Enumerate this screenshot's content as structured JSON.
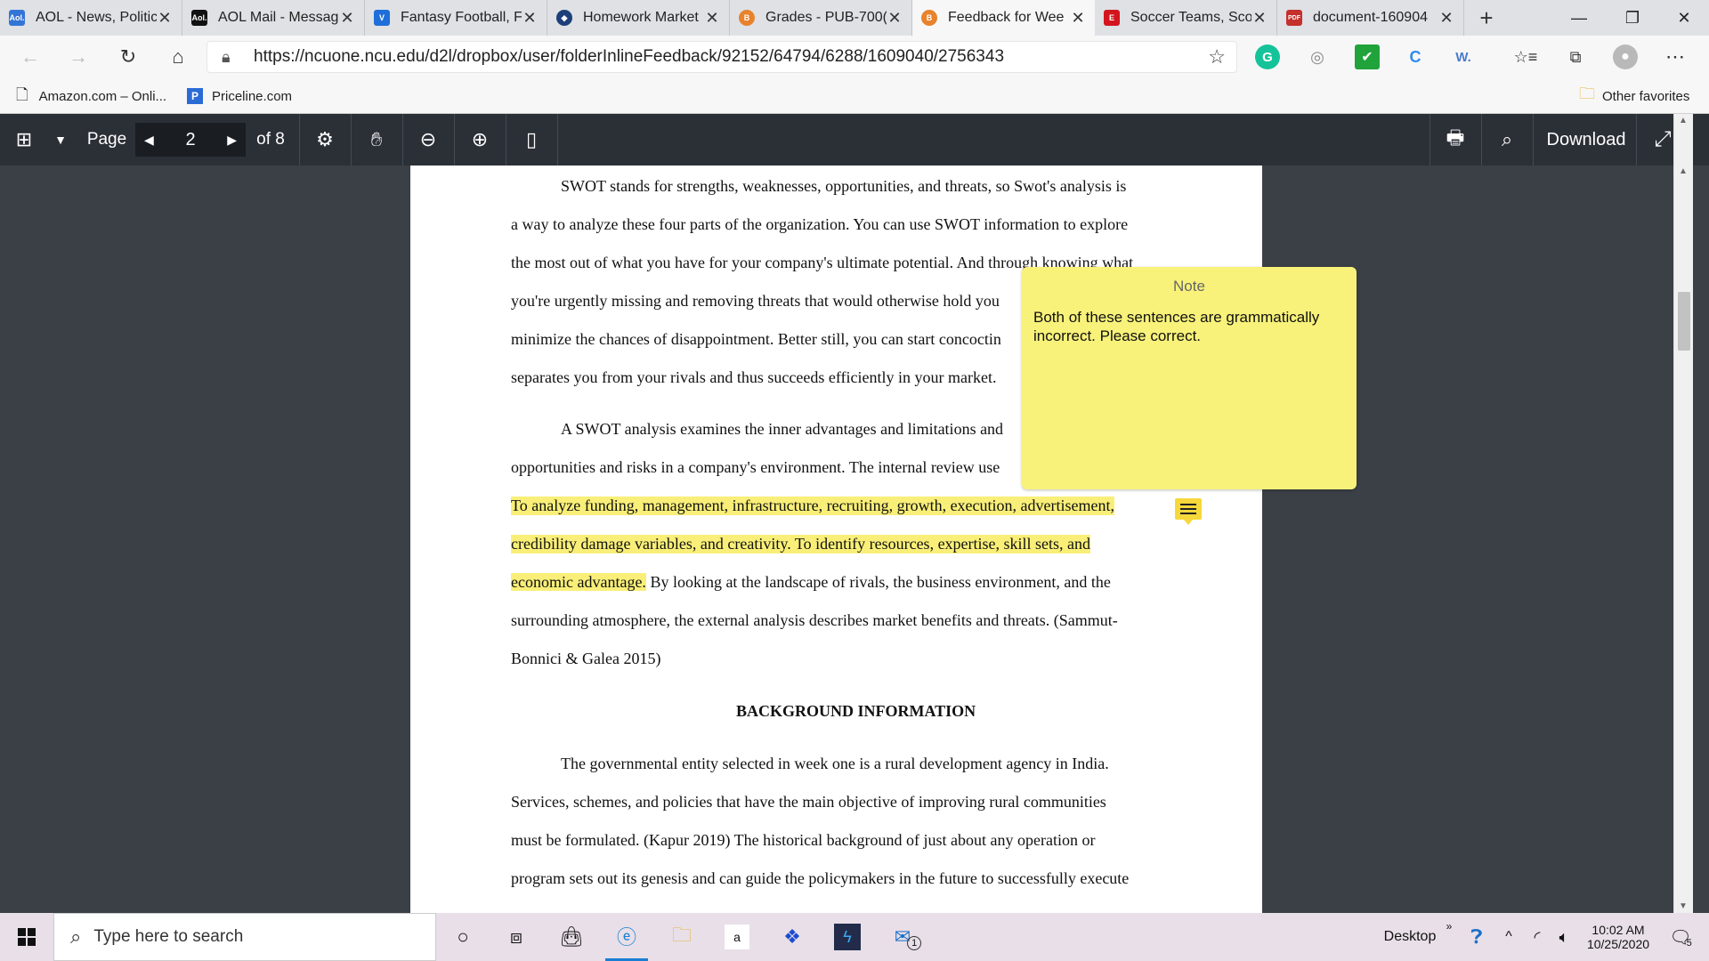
{
  "tabs": [
    {
      "title": "AOL - News, Politic",
      "fav": "Aol.",
      "color": "#3375d6"
    },
    {
      "title": "AOL Mail - Messag",
      "fav": "Aol.",
      "color": "#111111"
    },
    {
      "title": "Fantasy Football, F",
      "fav": "V",
      "color": "#1e6fd9"
    },
    {
      "title": "Homework Market",
      "fav": "◆",
      "color": "#1d3f7a"
    },
    {
      "title": "Grades - PUB-700(",
      "fav": "B",
      "color": "#e8822c"
    },
    {
      "title": "Feedback for Wee",
      "fav": "B",
      "color": "#e8822c"
    },
    {
      "title": "Soccer Teams, Sco",
      "fav": "E",
      "color": "#d3151e"
    },
    {
      "title": "document-160904",
      "fav": "PDF",
      "color": "#c4302b"
    }
  ],
  "url": "https://ncuone.ncu.edu/d2l/dropbox/user/folderInlineFeedback/92152/64794/6288/1609040/2756343",
  "bookmarks": {
    "b1": "Amazon.com – Onli...",
    "b2": "Priceline.com",
    "other": "Other favorites"
  },
  "viewer": {
    "page_label": "Page",
    "page_num": "2",
    "page_total": "of 8",
    "download": "Download"
  },
  "doc": {
    "lines": [
      "SWOT stands for strengths, weaknesses, opportunities, and threats, so Swot's analysis is",
      "a way to analyze these four parts of the organization. You can use SWOT information to explore",
      "the most out of what you have for your company's ultimate potential. And through knowing what",
      "you're urgently missing and removing threats that would otherwise hold you",
      "minimize the chances of disappointment. Better still, you can start concoctin",
      "separates you from your rivals and thus succeeds efficiently in your market.",
      "A SWOT analysis examines the inner advantages and limitations and",
      "opportunities and risks in a company's environment. The internal review use",
      "To analyze funding, management, infrastructure, recruiting, growth, execution, advertisement,",
      "credibility damage variables, and creativity. To identify resources, expertise, skill sets, and",
      "economic advantage.",
      " By looking at the landscape of rivals, the business environment, and the",
      "surrounding atmosphere, the external analysis describes market benefits and threats. (Sammut-",
      "Bonnici & Galea 2015)",
      "BACKGROUND INFORMATION",
      "The governmental entity selected in week one is a rural development agency in India.",
      "Services, schemes, and policies that have the main objective of improving rural communities",
      "must be formulated. (Kapur 2019)  The historical background of just about any operation or",
      "program sets out its genesis and can guide the policymakers in the future to successfully execute"
    ]
  },
  "note": {
    "title": "Note",
    "body": "Both of these sentences are grammatically incorrect. Please correct."
  },
  "taskbar": {
    "search": "Type here to search",
    "desktop": "Desktop",
    "time": "10:02 AM",
    "date": "10/25/2020",
    "notif": "5",
    "mail_badge": "1"
  }
}
